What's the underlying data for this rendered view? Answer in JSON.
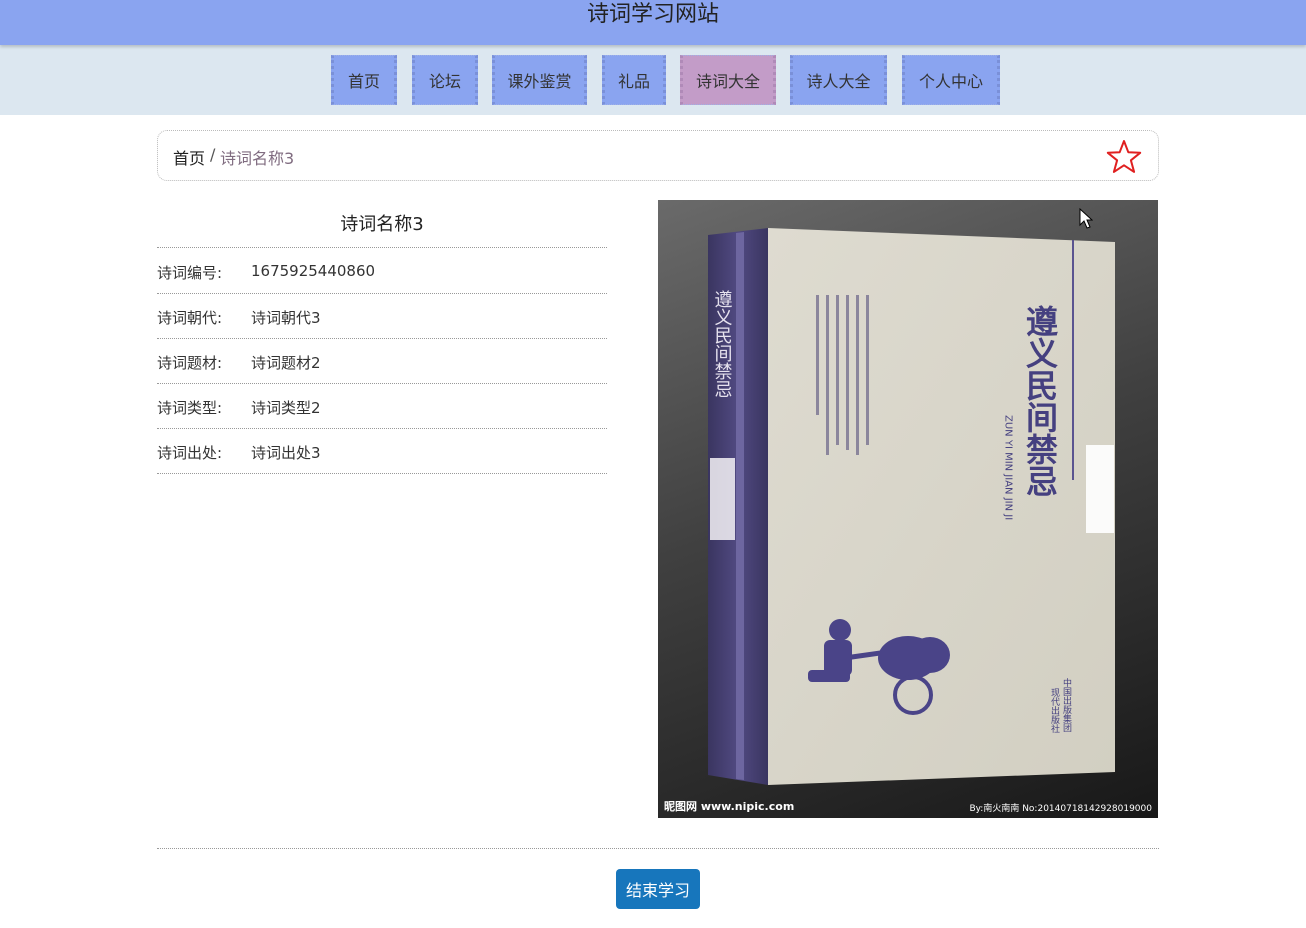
{
  "site": {
    "title": "诗词学习网站"
  },
  "nav": {
    "items": [
      {
        "label": "首页",
        "active": false
      },
      {
        "label": "论坛",
        "active": false
      },
      {
        "label": "课外鉴赏",
        "active": false
      },
      {
        "label": "礼品",
        "active": false
      },
      {
        "label": "诗词大全",
        "active": true
      },
      {
        "label": "诗人大全",
        "active": false
      },
      {
        "label": "个人中心",
        "active": false
      }
    ]
  },
  "breadcrumb": {
    "home": "首页",
    "separator": "/",
    "current": "诗词名称3"
  },
  "favorite_icon": "star-outline-icon",
  "poem": {
    "title": "诗词名称3",
    "fields": [
      {
        "label": "诗词编号:",
        "value": "1675925440860"
      },
      {
        "label": "诗词朝代:",
        "value": "诗词朝代3"
      },
      {
        "label": "诗词题材:",
        "value": "诗词题材2"
      },
      {
        "label": "诗词类型:",
        "value": "诗词类型2"
      },
      {
        "label": "诗词出处:",
        "value": "诗词出处3"
      }
    ]
  },
  "cover": {
    "book_title": "遵义民间禁忌",
    "pinyin": "ZUN YI MIN JIAN JIN JI",
    "publisher": "中国出版集团",
    "publisher_sub": "现代出版社",
    "watermark_left": "昵图网 www.nipic.com",
    "watermark_right": "By:南火南南 No:20140718142928019000"
  },
  "actions": {
    "end_label": "结束学习"
  },
  "colors": {
    "header": "#8aa4f0",
    "nav_bg": "#dce7f0",
    "nav_active": "#c39cc8",
    "button": "#1776bc",
    "star": "#e02020"
  }
}
